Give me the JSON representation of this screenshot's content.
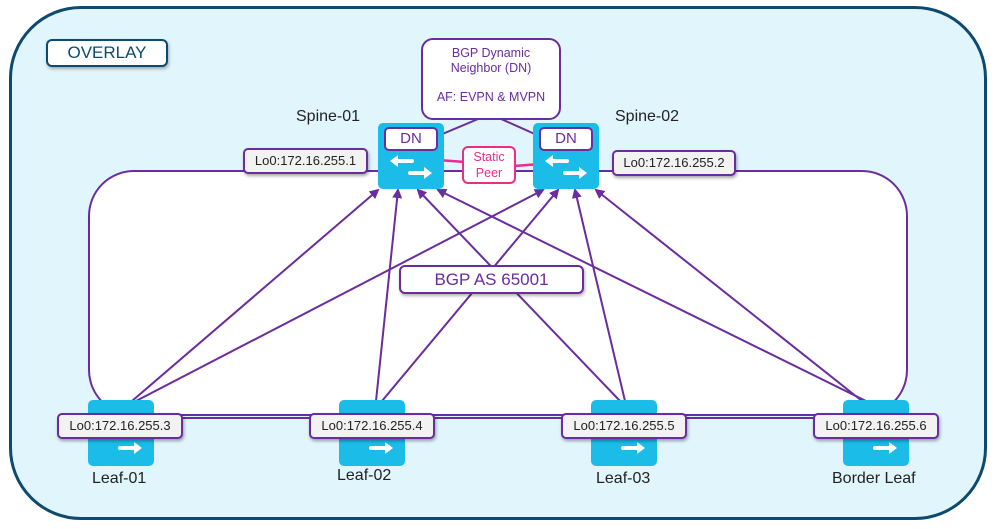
{
  "overlay_label": "OVERLAY",
  "dn_note": {
    "line1": "BGP Dynamic",
    "line2": "Neighbor (DN)",
    "line3": "AF: EVPN & MVPN"
  },
  "static_peer": {
    "line1": "Static",
    "line2": "Peer"
  },
  "bgp_as": "BGP AS 65001",
  "colors": {
    "frame_border": "#0d4a6e",
    "frame_fill": "#e0f5fc",
    "link": "#6a2c9e",
    "static_peer": "#ea2c8c",
    "switch": "#1bbce8"
  },
  "spines": [
    {
      "name": "Spine-01",
      "loopback": "Lo0:172.16.255.1",
      "badge": "DN",
      "icon": "switch-icon"
    },
    {
      "name": "Spine-02",
      "loopback": "Lo0:172.16.255.2",
      "badge": "DN",
      "icon": "switch-icon"
    }
  ],
  "leaves": [
    {
      "name": "Leaf-01",
      "loopback": "Lo0:172.16.255.3",
      "icon": "switch-icon"
    },
    {
      "name": "Leaf-02",
      "loopback": "Lo0:172.16.255.4",
      "icon": "switch-icon"
    },
    {
      "name": "Leaf-03",
      "loopback": "Lo0:172.16.255.5",
      "icon": "switch-icon"
    },
    {
      "name": "Border Leaf",
      "loopback": "Lo0:172.16.255.6",
      "icon": "switch-icon"
    }
  ],
  "links": {
    "leaf_to_spine": "every leaf peers to both spines",
    "spine_to_spine": "static peer"
  }
}
